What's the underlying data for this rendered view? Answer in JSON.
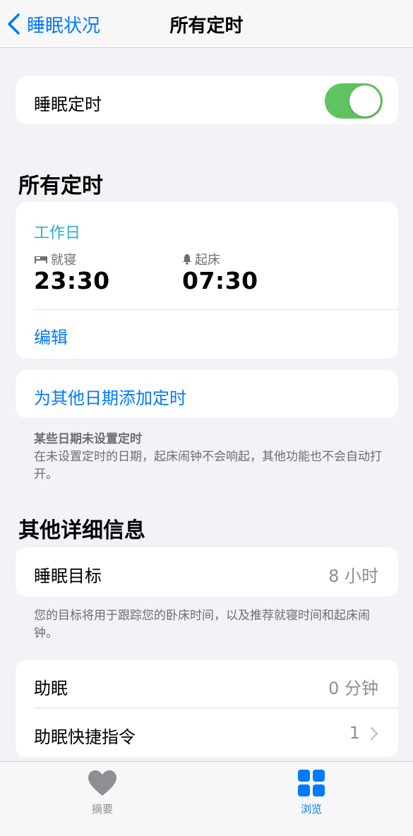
{
  "nav": {
    "back_label": "睡眠状况",
    "title": "所有定时"
  },
  "sleep_schedule": {
    "label": "睡眠定时",
    "enabled": true
  },
  "all_schedules": {
    "title": "所有定时",
    "schedule": {
      "days": "工作日",
      "bedtime_label": "就寝",
      "bedtime": "23:30",
      "wake_label": "起床",
      "wake": "07:30",
      "edit_label": "编辑"
    },
    "add_label": "为其他日期添加定时",
    "note_title": "某些日期未设置定时",
    "note_body": "在未设置定时的日期，起床闹钟不会响起，其他功能也不会自动打开。"
  },
  "details": {
    "title": "其他详细信息",
    "sleep_goal_label": "睡眠目标",
    "sleep_goal_value": "8 小时",
    "goal_note": "您的目标将用于跟踪您的卧床时间，以及推荐就寝时间和起床闹钟。",
    "wind_down_label": "助眠",
    "wind_down_value": "0 分钟",
    "shortcuts_label": "助眠快捷指令",
    "shortcuts_value": "1"
  },
  "tabbar": {
    "summary_label": "摘要",
    "browse_label": "浏览",
    "active_color": "#007aff",
    "inactive_color": "#8e8e93"
  }
}
